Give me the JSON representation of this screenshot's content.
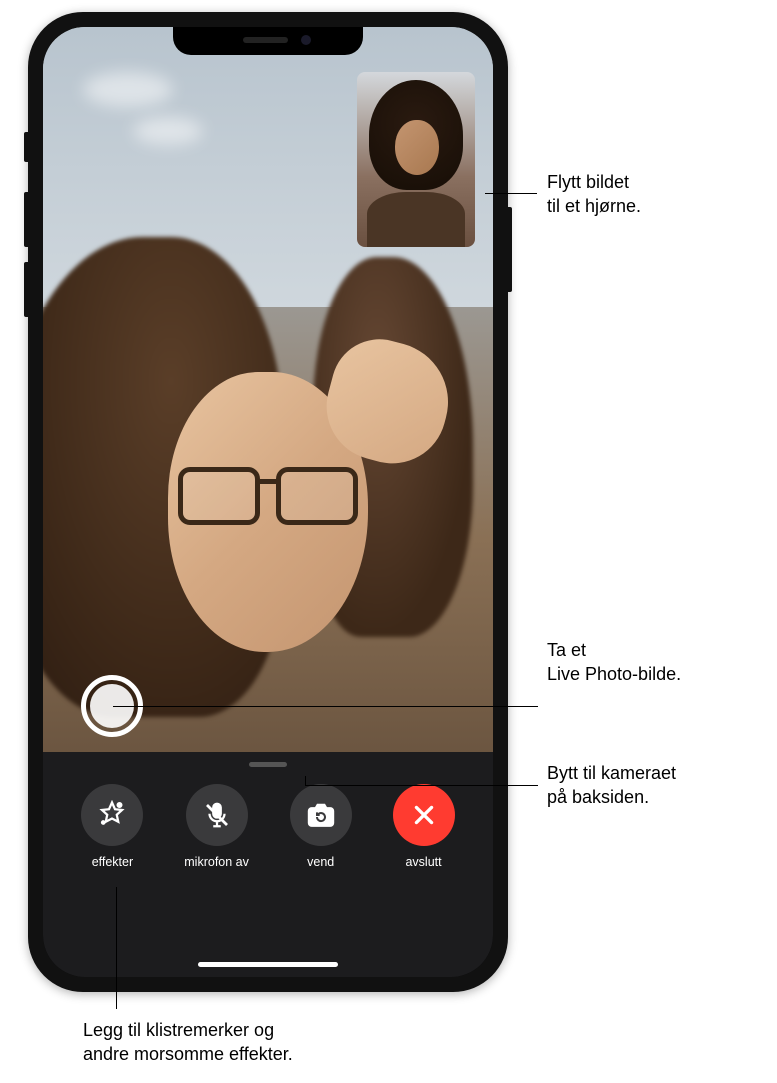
{
  "controls": {
    "effects": "effekter",
    "mute": "mikrofon av",
    "flip": "vend",
    "end": "avslutt"
  },
  "callouts": {
    "pip": "Flytt bildet\ntil et hjørne.",
    "shutter": "Ta et\nLive Photo-bilde.",
    "flip": "Bytt til kameraet\npå baksiden.",
    "effects": "Legg til klistremerker og\nandre morsomme effekter."
  }
}
